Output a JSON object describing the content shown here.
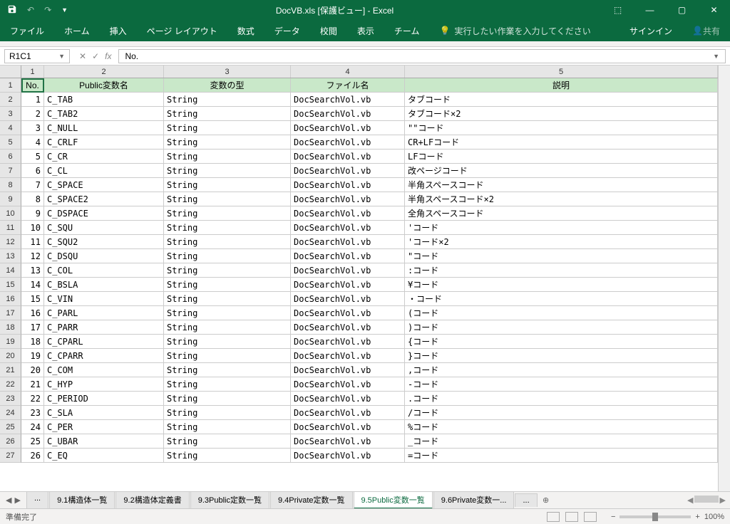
{
  "title": "DocVB.xls  [保護ビュー] - Excel",
  "qat": {
    "save": "save",
    "undo": "undo",
    "redo": "redo",
    "touch": "touch"
  },
  "win_controls": {
    "ribbon_opts": "▢",
    "min": "—",
    "max": "▢",
    "close": "✕"
  },
  "ribbon_tabs": [
    "ファイル",
    "ホーム",
    "挿入",
    "ページ レイアウト",
    "数式",
    "データ",
    "校閲",
    "表示",
    "チーム"
  ],
  "tell_me": {
    "icon": "💡",
    "text": "実行したい作業を入力してください"
  },
  "signin": "サインイン",
  "share": "共有",
  "name_box": "R1C1",
  "formula_value": "No.",
  "col_headers": [
    "1",
    "2",
    "3",
    "4",
    "5"
  ],
  "table_headers": {
    "no": "No.",
    "name": "Public変数名",
    "type": "変数の型",
    "file": "ファイル名",
    "desc": "説明"
  },
  "rows": [
    {
      "no": "1",
      "name": "C_TAB",
      "type": "String",
      "file": "DocSearchVol.vb",
      "desc": "タブコード"
    },
    {
      "no": "2",
      "name": "C_TAB2",
      "type": "String",
      "file": "DocSearchVol.vb",
      "desc": "タブコード×2"
    },
    {
      "no": "3",
      "name": "C_NULL",
      "type": "String",
      "file": "DocSearchVol.vb",
      "desc": "\"\"コード"
    },
    {
      "no": "4",
      "name": "C_CRLF",
      "type": "String",
      "file": "DocSearchVol.vb",
      "desc": "CR+LFコード"
    },
    {
      "no": "5",
      "name": "C_CR",
      "type": "String",
      "file": "DocSearchVol.vb",
      "desc": "LFコード"
    },
    {
      "no": "6",
      "name": "C_CL",
      "type": "String",
      "file": "DocSearchVol.vb",
      "desc": "改ページコード"
    },
    {
      "no": "7",
      "name": "C_SPACE",
      "type": "String",
      "file": "DocSearchVol.vb",
      "desc": "半角スペースコード"
    },
    {
      "no": "8",
      "name": "C_SPACE2",
      "type": "String",
      "file": "DocSearchVol.vb",
      "desc": "半角スペースコード×2"
    },
    {
      "no": "9",
      "name": "C_DSPACE",
      "type": "String",
      "file": "DocSearchVol.vb",
      "desc": "全角スペースコード"
    },
    {
      "no": "10",
      "name": "C_SQU",
      "type": "String",
      "file": "DocSearchVol.vb",
      "desc": "'コード"
    },
    {
      "no": "11",
      "name": "C_SQU2",
      "type": "String",
      "file": "DocSearchVol.vb",
      "desc": "'コード×2"
    },
    {
      "no": "12",
      "name": "C_DSQU",
      "type": "String",
      "file": "DocSearchVol.vb",
      "desc": "\"コード"
    },
    {
      "no": "13",
      "name": "C_COL",
      "type": "String",
      "file": "DocSearchVol.vb",
      "desc": ":コード"
    },
    {
      "no": "14",
      "name": "C_BSLA",
      "type": "String",
      "file": "DocSearchVol.vb",
      "desc": "¥コード"
    },
    {
      "no": "15",
      "name": "C_VIN",
      "type": "String",
      "file": "DocSearchVol.vb",
      "desc": "・コード"
    },
    {
      "no": "16",
      "name": "C_PARL",
      "type": "String",
      "file": "DocSearchVol.vb",
      "desc": "(コード"
    },
    {
      "no": "17",
      "name": "C_PARR",
      "type": "String",
      "file": "DocSearchVol.vb",
      "desc": ")コード"
    },
    {
      "no": "18",
      "name": "C_CPARL",
      "type": "String",
      "file": "DocSearchVol.vb",
      "desc": "{コード"
    },
    {
      "no": "19",
      "name": "C_CPARR",
      "type": "String",
      "file": "DocSearchVol.vb",
      "desc": "}コード"
    },
    {
      "no": "20",
      "name": "C_COM",
      "type": "String",
      "file": "DocSearchVol.vb",
      "desc": ",コード"
    },
    {
      "no": "21",
      "name": "C_HYP",
      "type": "String",
      "file": "DocSearchVol.vb",
      "desc": " -コード"
    },
    {
      "no": "22",
      "name": "C_PERIOD",
      "type": "String",
      "file": "DocSearchVol.vb",
      "desc": ".コード"
    },
    {
      "no": "23",
      "name": "C_SLA",
      "type": "String",
      "file": "DocSearchVol.vb",
      "desc": "/コード"
    },
    {
      "no": "24",
      "name": "C_PER",
      "type": "String",
      "file": "DocSearchVol.vb",
      "desc": "%コード"
    },
    {
      "no": "25",
      "name": "C_UBAR",
      "type": "String",
      "file": "DocSearchVol.vb",
      "desc": "_コード"
    },
    {
      "no": "26",
      "name": "C_EQ",
      "type": "String",
      "file": "DocSearchVol.vb",
      "desc": " =コード"
    }
  ],
  "sheet_tabs": [
    "...",
    "9.1構造体一覧",
    "9.2構造体定義書",
    "9.3Public定数一覧",
    "9.4Private定数一覧",
    "9.5Public変数一覧",
    "9.6Private変数一..."
  ],
  "active_sheet_index": 5,
  "status": {
    "ready": "準備完了",
    "zoom": "100%"
  }
}
